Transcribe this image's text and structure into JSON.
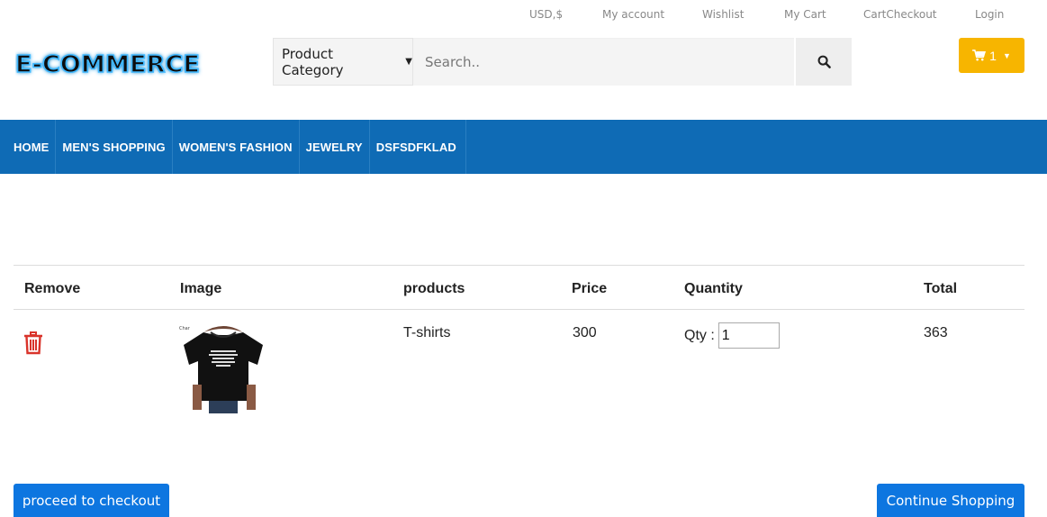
{
  "top_links": {
    "currency": "USD,$",
    "my_account": "My account",
    "wishlist": "Wishlist",
    "my_cart": "My Cart",
    "cart_checkout": "CartCheckout",
    "login": "Login"
  },
  "brand": {
    "logo_text": "E-COMMERCE"
  },
  "search": {
    "category_label": "Product Category",
    "placeholder": "Search.."
  },
  "cart_button": {
    "count": "1"
  },
  "nav": {
    "items": [
      "HOME",
      "MEN'S SHOPPING",
      "WOMEN'S FASHION",
      "JEWELRY",
      "DSFSDFKLAD"
    ]
  },
  "cart_table": {
    "headers": {
      "remove": "Remove",
      "image": "Image",
      "products": "products",
      "price": "Price",
      "quantity": "Quantity",
      "total": "Total"
    },
    "rows": [
      {
        "product": "T-shirts",
        "price": "300",
        "qty_label": "Qty :",
        "qty_value": "1",
        "total": "363"
      }
    ]
  },
  "actions": {
    "checkout_label": "proceed to checkout",
    "continue_label": "Continue Shopping"
  },
  "colors": {
    "nav_bg": "#0f6bb5",
    "cart_button": "#f7b500",
    "primary_button": "#0d76e0",
    "delete_icon": "#d9342b"
  }
}
